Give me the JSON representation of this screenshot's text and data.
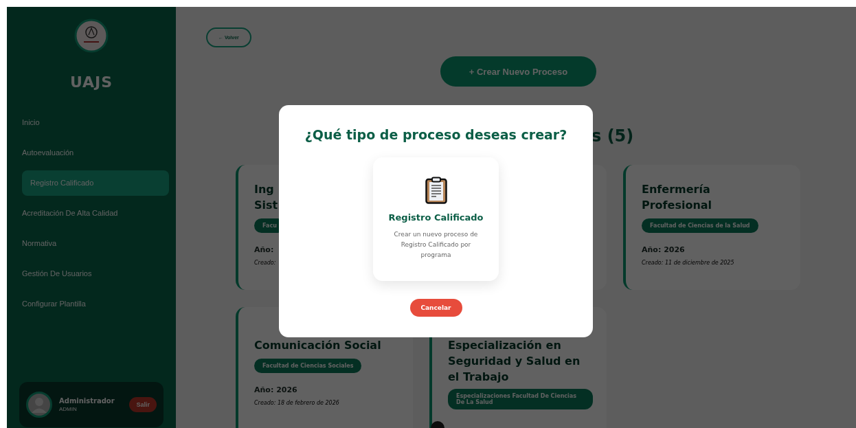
{
  "sidebar": {
    "brand": "UAJS",
    "nav": [
      {
        "label": "Inicio",
        "selected": false
      },
      {
        "label": "Autoevaluación",
        "selected": false
      },
      {
        "label": "Registro Calificado",
        "selected": true
      },
      {
        "label": "Acreditación De Alta Calidad",
        "selected": false
      },
      {
        "label": "Normativa",
        "selected": false
      },
      {
        "label": "Gestión De Usuarios",
        "selected": false
      },
      {
        "label": "Configurar Plantilla",
        "selected": false
      }
    ],
    "user": {
      "name": "Administrador",
      "role": "ADMIN",
      "logout": "Salir"
    }
  },
  "main": {
    "back_button": "← Volver",
    "create_button": "+ Crear Nuevo Proceso",
    "heading": "s (5)",
    "cards": [
      {
        "title_lines": [
          "Ing",
          "Sist"
        ],
        "badge": "Facu",
        "year": "Año:",
        "created": "Creado:"
      },
      {
        "title_lines": [
          "Enfermería",
          "Profesional"
        ],
        "badge": "Facultad de Ciencias de la Salud",
        "year": "Año: 2026",
        "created": "Creado: 11 de diciembre de 2025"
      },
      {
        "title_lines": [
          "Comunicación Social"
        ],
        "badge": "Facultad de Ciencias Sociales",
        "year": "Año: 2026",
        "created": "Creado: 18 de febrero de 2026"
      },
      {
        "title_lines": [
          "Especialización en",
          "Seguridad y Salud en",
          "el Trabajo"
        ],
        "badge": "Especializaciones Facultad De Ciencias De La Salud"
      }
    ]
  },
  "modal": {
    "title": "¿Qué tipo de proceso deseas crear?",
    "options": [
      {
        "title": "Registro Calificado",
        "description": "Crear un nuevo proceso de Registro Calificado por programa"
      }
    ],
    "cancel": "Cancelar"
  }
}
